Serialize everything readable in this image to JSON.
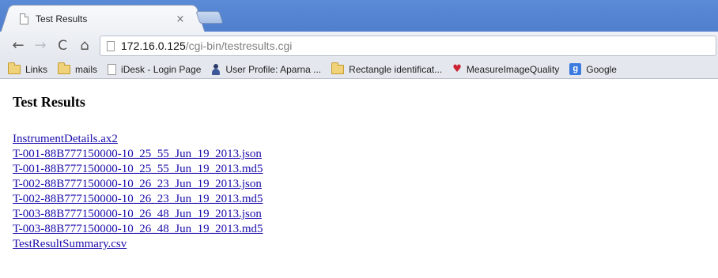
{
  "tab": {
    "title": "Test Results",
    "close_glyph": "×"
  },
  "toolbar": {
    "back_glyph": "←",
    "forward_glyph": "→",
    "reload_glyph": "C",
    "home_glyph": "⌂",
    "url_host": "172.16.0.125",
    "url_path": "/cgi-bin/testresults.cgi"
  },
  "bookmarks": [
    {
      "label": "Links",
      "icon": "folder-icon"
    },
    {
      "label": "mails",
      "icon": "folder-icon"
    },
    {
      "label": "iDesk - Login Page",
      "icon": "page-icon"
    },
    {
      "label": "User Profile: Aparna ...",
      "icon": "user-icon"
    },
    {
      "label": "Rectangle identificat...",
      "icon": "folder-icon"
    },
    {
      "label": "MeasureImageQuality",
      "icon": "heart-icon"
    },
    {
      "label": "Google",
      "icon": "google-icon"
    }
  ],
  "page": {
    "heading": "Test Results",
    "files": [
      "InstrumentDetails.ax2",
      "T-001-88B777150000-10_25_55_Jun_19_2013.json",
      "T-001-88B777150000-10_25_55_Jun_19_2013.md5",
      "T-002-88B777150000-10_26_23_Jun_19_2013.json",
      "T-002-88B777150000-10_26_23_Jun_19_2013.md5",
      "T-003-88B777150000-10_26_48_Jun_19_2013.json",
      "T-003-88B777150000-10_26_48_Jun_19_2013.md5",
      "TestResultSummary.csv"
    ]
  },
  "colors": {
    "tabstrip": "#5b8bd6",
    "link": "#1a0dab"
  }
}
